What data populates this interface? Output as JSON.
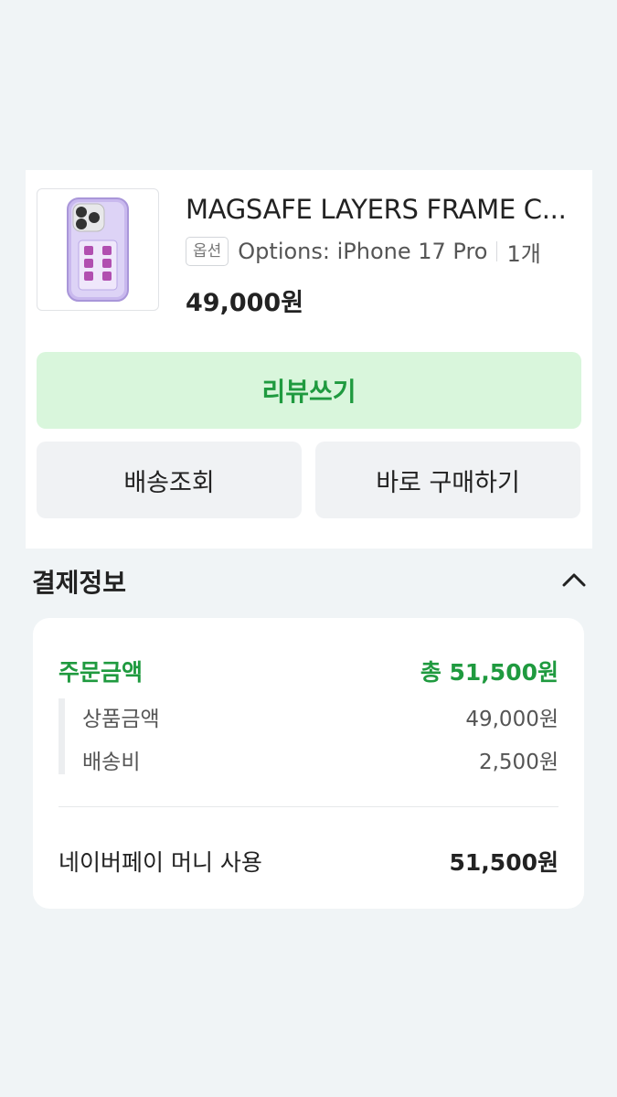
{
  "product": {
    "name": "MAGSAFE LAYERS FRAME C...",
    "option_badge": "옵션",
    "option_text": "Options: iPhone 17 Pro",
    "quantity": "1개",
    "price": "49,000원",
    "image_icon": "phone-case-image"
  },
  "actions": {
    "review": "리뷰쓰기",
    "track_delivery": "배송조회",
    "buy_again": "바로 구매하기"
  },
  "payment": {
    "section_title": "결제정보",
    "toggle_icon": "chevron-up-icon",
    "order_label": "주문금액",
    "order_total": "총 51,500원",
    "items": [
      {
        "label": "상품금액",
        "value": "49,000원"
      },
      {
        "label": "배송비",
        "value": "2,500원"
      }
    ],
    "method_label": "네이버페이 머니 사용",
    "method_amount": "51,500원"
  },
  "colors": {
    "accent_green": "#1f9a3f",
    "review_bg": "#d9f6dc",
    "page_bg": "#f0f4f6"
  }
}
